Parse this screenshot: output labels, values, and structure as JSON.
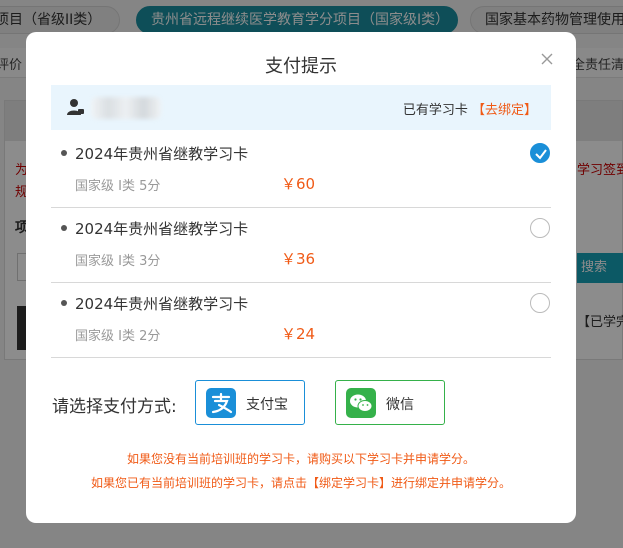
{
  "background": {
    "tabs": [
      {
        "label": "项目（省级II类）"
      },
      {
        "label": "贵州省远程继续医学教育学分项目（国家级I类）"
      },
      {
        "label": "国家基本药物管理使用"
      }
    ],
    "subbar_left": "评价",
    "subbar_right": "全责任清",
    "notice_left_1": "为",
    "notice_left_2": "规",
    "notice_right": "学习签到",
    "label_left": "项",
    "search_label": "搜索",
    "status_right": "【已学完"
  },
  "modal": {
    "title": "支付提示",
    "account": {
      "has_card_text": "已有学习卡",
      "unbind_text": "【去绑定】"
    },
    "cards": [
      {
        "name": "2024年贵州省继教学习卡",
        "level": "国家级 I类 5分",
        "price": "￥60",
        "selected": true
      },
      {
        "name": "2024年贵州省继教学习卡",
        "level": "国家级 I类 3分",
        "price": "￥36",
        "selected": false
      },
      {
        "name": "2024年贵州省继教学习卡",
        "level": "国家级 I类 2分",
        "price": "￥24",
        "selected": false
      }
    ],
    "payment": {
      "label": "请选择支付方式:",
      "alipay_label": "支付宝",
      "wechat_label": "微信"
    },
    "notices": [
      "如果您没有当前培训班的学习卡，请购买以下学习卡并申请学分。",
      "如果您已有当前培训班的学习卡，请点击【绑定学习卡】进行绑定并申请学分。"
    ]
  },
  "colors": {
    "accent_blue": "#1a8fd8",
    "orange": "#f05a16",
    "wechat_green": "#35b14a",
    "teal_tab": "#1a8fa0"
  },
  "icons": [
    "close-icon",
    "user-icon",
    "check-icon",
    "alipay-icon",
    "wechat-icon"
  ]
}
